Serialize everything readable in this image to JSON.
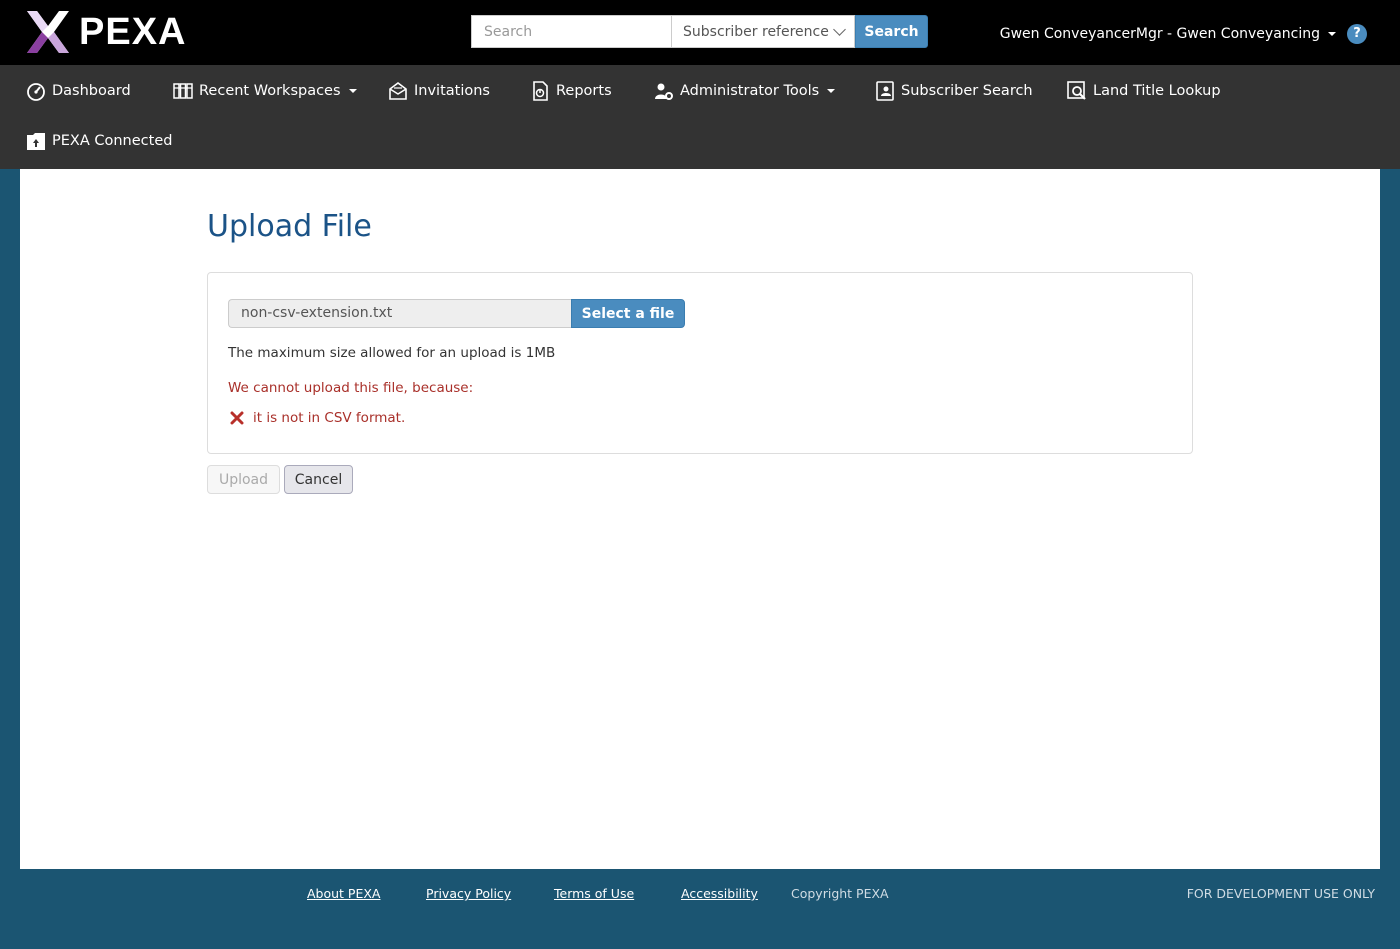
{
  "header": {
    "logo_text": "PEXA",
    "search": {
      "placeholder": "Search",
      "type_selected": "Subscriber reference",
      "button_label": "Search"
    },
    "user_label": "Gwen ConveyancerMgr - Gwen Conveyancing",
    "help_label": "?"
  },
  "nav": {
    "items": [
      {
        "label": "Dashboard",
        "icon": "dashboard-icon"
      },
      {
        "label": "Recent Workspaces",
        "icon": "workspaces-icon",
        "dropdown": true
      },
      {
        "label": "Invitations",
        "icon": "invitations-icon"
      },
      {
        "label": "Reports",
        "icon": "reports-icon"
      },
      {
        "label": "Administrator Tools",
        "icon": "admin-tools-icon",
        "dropdown": true
      },
      {
        "label": "Subscriber Search",
        "icon": "subscriber-search-icon"
      },
      {
        "label": "Land Title Lookup",
        "icon": "land-title-lookup-icon"
      },
      {
        "label": "PEXA Connected",
        "icon": "pexa-connected-icon"
      }
    ]
  },
  "main": {
    "title": "Upload File",
    "file": {
      "name": "non-csv-extension.txt",
      "select_label": "Select a file"
    },
    "max_size_text": "The maximum size allowed for an upload is 1MB",
    "error_heading": "We cannot upload this file, because:",
    "errors": [
      "it is not in CSV format."
    ],
    "buttons": {
      "upload": "Upload",
      "cancel": "Cancel"
    }
  },
  "footer": {
    "links": [
      "About PEXA",
      "Privacy Policy",
      "Terms of Use",
      "Accessibility"
    ],
    "copyright": "Copyright PEXA",
    "env_notice": "FOR DEVELOPMENT USE ONLY"
  },
  "colors": {
    "accent": "#4a8cbf",
    "title": "#1b5387",
    "error": "#a9302a",
    "background": "#1b5572",
    "navbar": "#333333",
    "topbar": "#000000"
  }
}
